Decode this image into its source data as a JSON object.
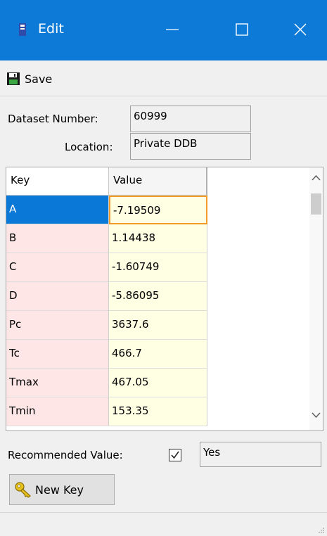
{
  "window": {
    "title": "Edit",
    "accent": "#0c7ad6"
  },
  "toolbar": {
    "save_label": "Save"
  },
  "info": {
    "dataset_label": "Dataset Number:",
    "dataset_value": "60999",
    "location_label": "Location:",
    "location_value": "Private DDB"
  },
  "grid": {
    "headers": {
      "key": "Key",
      "value": "Value"
    },
    "rows": [
      {
        "key": "A",
        "value": "-7.19509"
      },
      {
        "key": "B",
        "value": "1.14438"
      },
      {
        "key": "C",
        "value": "-1.60749"
      },
      {
        "key": "D",
        "value": "-5.86095"
      },
      {
        "key": "Pc",
        "value": "3637.6"
      },
      {
        "key": "Tc",
        "value": "466.7"
      },
      {
        "key": "Tmax",
        "value": "467.05"
      },
      {
        "key": "Tmin",
        "value": "153.35"
      }
    ],
    "selected_row": 0
  },
  "recommended": {
    "label": "Recommended Value:",
    "checked": true,
    "value": "Yes"
  },
  "new_key": {
    "label": "New Key"
  },
  "colors": {
    "key_cell": "#ffe6e6",
    "value_cell": "#ffffe4",
    "selection": "#0a78d6",
    "focus_border": "#f29b26"
  }
}
